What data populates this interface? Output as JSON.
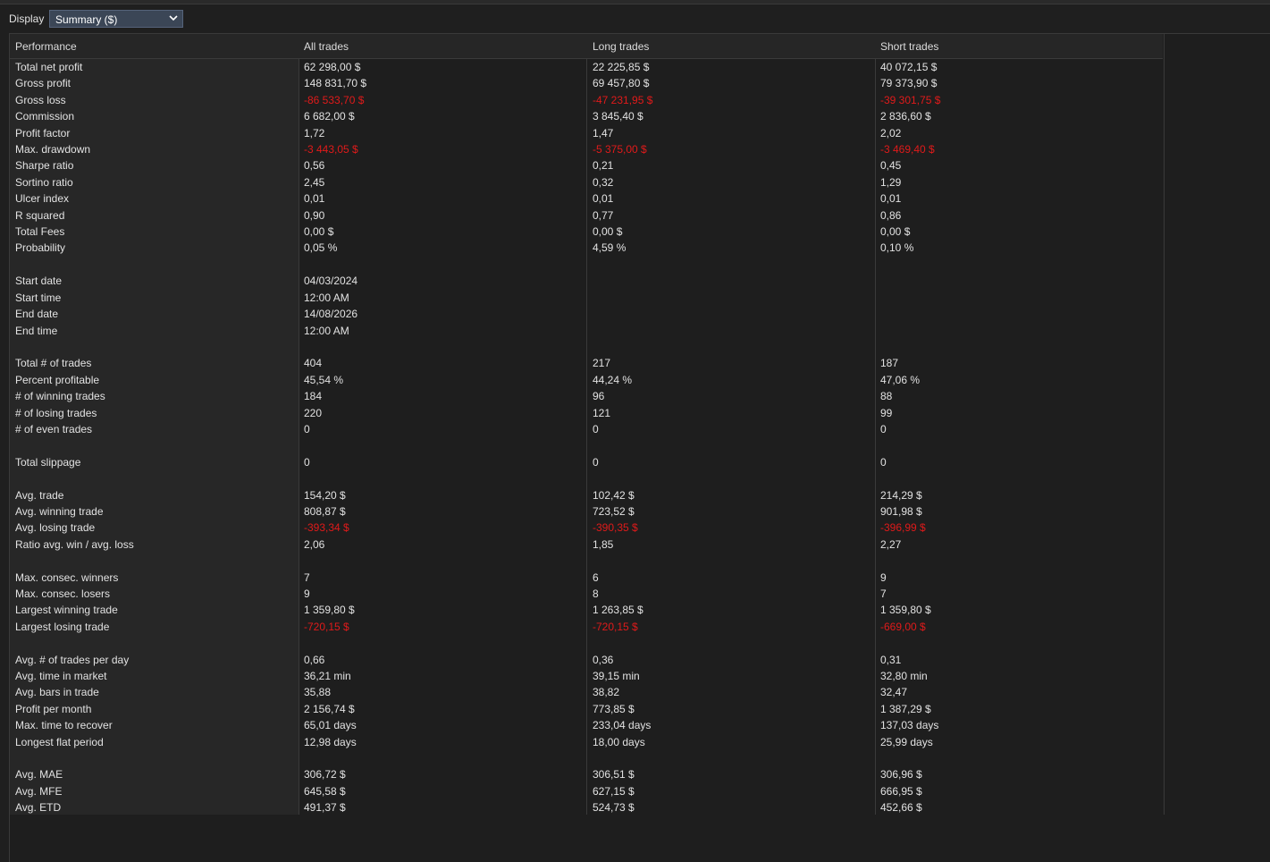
{
  "toolbar": {
    "display_label": "Display",
    "display_value": "Summary ($)"
  },
  "table": {
    "headers": [
      "Performance",
      "All trades",
      "Long trades",
      "Short trades"
    ],
    "negative_color": "#e01a1a",
    "rows": [
      {
        "label": "Total net profit",
        "values": [
          "62 298,00 $",
          "22 225,85 $",
          "40 072,15 $"
        ],
        "neg": [
          false,
          false,
          false
        ]
      },
      {
        "label": "Gross profit",
        "values": [
          "148 831,70 $",
          "69 457,80 $",
          "79 373,90 $"
        ],
        "neg": [
          false,
          false,
          false
        ]
      },
      {
        "label": "Gross loss",
        "values": [
          "-86 533,70 $",
          "-47 231,95 $",
          "-39 301,75 $"
        ],
        "neg": [
          true,
          true,
          true
        ]
      },
      {
        "label": "Commission",
        "values": [
          "6 682,00 $",
          "3 845,40 $",
          "2 836,60 $"
        ],
        "neg": [
          false,
          false,
          false
        ]
      },
      {
        "label": "Profit factor",
        "values": [
          "1,72",
          "1,47",
          "2,02"
        ],
        "neg": [
          false,
          false,
          false
        ]
      },
      {
        "label": "Max. drawdown",
        "values": [
          "-3 443,05 $",
          "-5 375,00 $",
          "-3 469,40 $"
        ],
        "neg": [
          true,
          true,
          true
        ]
      },
      {
        "label": "Sharpe ratio",
        "values": [
          "0,56",
          "0,21",
          "0,45"
        ],
        "neg": [
          false,
          false,
          false
        ]
      },
      {
        "label": "Sortino ratio",
        "values": [
          "2,45",
          "0,32",
          "1,29"
        ],
        "neg": [
          false,
          false,
          false
        ]
      },
      {
        "label": "Ulcer index",
        "values": [
          "0,01",
          "0,01",
          "0,01"
        ],
        "neg": [
          false,
          false,
          false
        ]
      },
      {
        "label": "R squared",
        "values": [
          "0,90",
          "0,77",
          "0,86"
        ],
        "neg": [
          false,
          false,
          false
        ]
      },
      {
        "label": "Total Fees",
        "values": [
          "0,00 $",
          "0,00 $",
          "0,00 $"
        ],
        "neg": [
          false,
          false,
          false
        ]
      },
      {
        "label": "Probability",
        "values": [
          "0,05 %",
          "4,59 %",
          "0,10 %"
        ],
        "neg": [
          false,
          false,
          false
        ]
      },
      {
        "label": "",
        "values": [
          "",
          "",
          ""
        ],
        "neg": [
          false,
          false,
          false
        ]
      },
      {
        "label": "Start date",
        "values": [
          "04/03/2024",
          "",
          ""
        ],
        "neg": [
          false,
          false,
          false
        ]
      },
      {
        "label": "Start time",
        "values": [
          "12:00 AM",
          "",
          ""
        ],
        "neg": [
          false,
          false,
          false
        ]
      },
      {
        "label": "End date",
        "values": [
          "14/08/2026",
          "",
          ""
        ],
        "neg": [
          false,
          false,
          false
        ]
      },
      {
        "label": "End time",
        "values": [
          "12:00 AM",
          "",
          ""
        ],
        "neg": [
          false,
          false,
          false
        ]
      },
      {
        "label": "",
        "values": [
          "",
          "",
          ""
        ],
        "neg": [
          false,
          false,
          false
        ]
      },
      {
        "label": "Total # of trades",
        "values": [
          "404",
          "217",
          "187"
        ],
        "neg": [
          false,
          false,
          false
        ]
      },
      {
        "label": "Percent profitable",
        "values": [
          "45,54 %",
          "44,24 %",
          "47,06 %"
        ],
        "neg": [
          false,
          false,
          false
        ]
      },
      {
        "label": "# of winning trades",
        "values": [
          "184",
          "96",
          "88"
        ],
        "neg": [
          false,
          false,
          false
        ]
      },
      {
        "label": "# of losing trades",
        "values": [
          "220",
          "121",
          "99"
        ],
        "neg": [
          false,
          false,
          false
        ]
      },
      {
        "label": "# of even trades",
        "values": [
          "0",
          "0",
          "0"
        ],
        "neg": [
          false,
          false,
          false
        ]
      },
      {
        "label": "",
        "values": [
          "",
          "",
          ""
        ],
        "neg": [
          false,
          false,
          false
        ]
      },
      {
        "label": "Total slippage",
        "values": [
          "0",
          "0",
          "0"
        ],
        "neg": [
          false,
          false,
          false
        ]
      },
      {
        "label": "",
        "values": [
          "",
          "",
          ""
        ],
        "neg": [
          false,
          false,
          false
        ]
      },
      {
        "label": "Avg. trade",
        "values": [
          "154,20 $",
          "102,42 $",
          "214,29 $"
        ],
        "neg": [
          false,
          false,
          false
        ]
      },
      {
        "label": "Avg. winning trade",
        "values": [
          "808,87 $",
          "723,52 $",
          "901,98 $"
        ],
        "neg": [
          false,
          false,
          false
        ]
      },
      {
        "label": "Avg. losing trade",
        "values": [
          "-393,34 $",
          "-390,35 $",
          "-396,99 $"
        ],
        "neg": [
          true,
          true,
          true
        ]
      },
      {
        "label": "Ratio avg. win / avg. loss",
        "values": [
          "2,06",
          "1,85",
          "2,27"
        ],
        "neg": [
          false,
          false,
          false
        ]
      },
      {
        "label": "",
        "values": [
          "",
          "",
          ""
        ],
        "neg": [
          false,
          false,
          false
        ]
      },
      {
        "label": "Max. consec. winners",
        "values": [
          "7",
          "6",
          "9"
        ],
        "neg": [
          false,
          false,
          false
        ]
      },
      {
        "label": "Max. consec. losers",
        "values": [
          "9",
          "8",
          "7"
        ],
        "neg": [
          false,
          false,
          false
        ]
      },
      {
        "label": "Largest winning trade",
        "values": [
          "1 359,80 $",
          "1 263,85 $",
          "1 359,80 $"
        ],
        "neg": [
          false,
          false,
          false
        ]
      },
      {
        "label": "Largest losing trade",
        "values": [
          "-720,15 $",
          "-720,15 $",
          "-669,00 $"
        ],
        "neg": [
          true,
          true,
          true
        ]
      },
      {
        "label": "",
        "values": [
          "",
          "",
          ""
        ],
        "neg": [
          false,
          false,
          false
        ]
      },
      {
        "label": "Avg. # of trades per day",
        "values": [
          "0,66",
          "0,36",
          "0,31"
        ],
        "neg": [
          false,
          false,
          false
        ]
      },
      {
        "label": "Avg. time in market",
        "values": [
          "36,21 min",
          "39,15 min",
          "32,80 min"
        ],
        "neg": [
          false,
          false,
          false
        ]
      },
      {
        "label": "Avg. bars in trade",
        "values": [
          "35,88",
          "38,82",
          "32,47"
        ],
        "neg": [
          false,
          false,
          false
        ]
      },
      {
        "label": "Profit per month",
        "values": [
          "2 156,74 $",
          "773,85 $",
          "1 387,29 $"
        ],
        "neg": [
          false,
          false,
          false
        ]
      },
      {
        "label": "Max. time to recover",
        "values": [
          "65,01 days",
          "233,04 days",
          "137,03 days"
        ],
        "neg": [
          false,
          false,
          false
        ]
      },
      {
        "label": "Longest flat period",
        "values": [
          "12,98 days",
          "18,00 days",
          "25,99 days"
        ],
        "neg": [
          false,
          false,
          false
        ]
      },
      {
        "label": "",
        "values": [
          "",
          "",
          ""
        ],
        "neg": [
          false,
          false,
          false
        ]
      },
      {
        "label": "Avg. MAE",
        "values": [
          "306,72 $",
          "306,51 $",
          "306,96 $"
        ],
        "neg": [
          false,
          false,
          false
        ]
      },
      {
        "label": "Avg. MFE",
        "values": [
          "645,58 $",
          "627,15 $",
          "666,95 $"
        ],
        "neg": [
          false,
          false,
          false
        ]
      },
      {
        "label": "Avg. ETD",
        "values": [
          "491,37 $",
          "524,73 $",
          "452,66 $"
        ],
        "neg": [
          false,
          false,
          false
        ]
      }
    ]
  }
}
